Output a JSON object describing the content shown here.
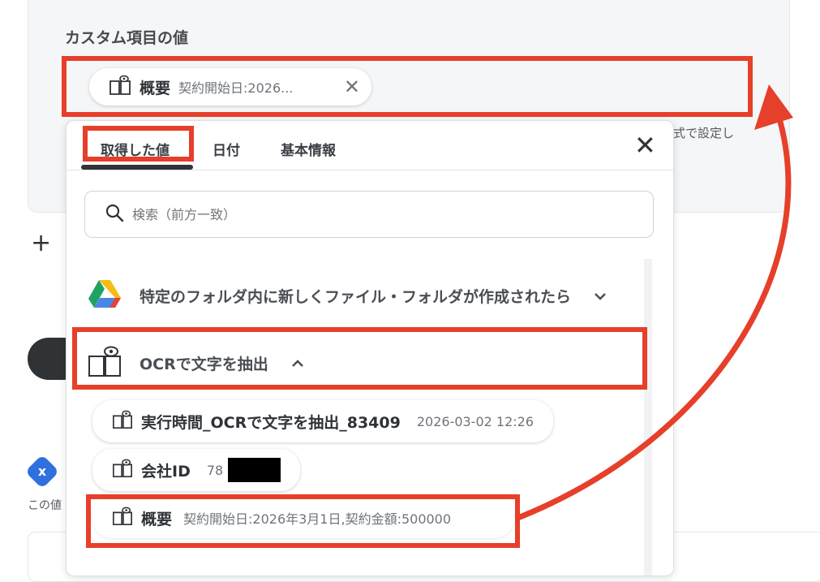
{
  "settings": {
    "section_title": "カスタム項目の値",
    "selected_chip": {
      "name": "概要",
      "value": "契約開始日:2026..."
    },
    "behind_text": "式で設定し",
    "small_text": "この値",
    "badge_letter": "x"
  },
  "popup": {
    "tabs": [
      {
        "label": "取得した値",
        "active": true
      },
      {
        "label": "日付",
        "active": false
      },
      {
        "label": "基本情報",
        "active": false
      }
    ],
    "search_placeholder": "検索（前方一致）",
    "groups": [
      {
        "label": "特定のフォルダ内に新しくファイル・フォルダが作成されたら",
        "expanded": false,
        "icon": "google-drive-icon"
      },
      {
        "label": "OCRで文字を抽出",
        "expanded": true,
        "icon": "ocr-book-icon"
      }
    ],
    "items": [
      {
        "name": "実行時間_OCRで文字を抽出_83409",
        "value": "2026-03-02 12:26"
      },
      {
        "name": "会社ID",
        "value": "78"
      },
      {
        "name": "概要",
        "value": "契約開始日:2026年3月1日,契約金額:500000"
      }
    ]
  },
  "colors": {
    "highlight": "#e63f2a",
    "accent": "#2f6fde"
  }
}
